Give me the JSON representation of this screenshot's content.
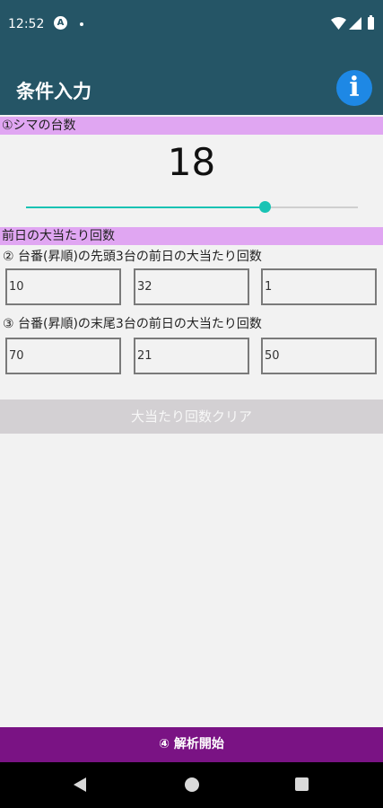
{
  "status_bar": {
    "time": "12:52",
    "a_icon_letter": "A",
    "icons": [
      "a-icon",
      "dot-icon",
      "wifi-icon",
      "signal-icon",
      "battery-icon"
    ]
  },
  "app_bar": {
    "title": "条件入力",
    "info_icon_glyph": "i",
    "background": "#255566",
    "info_color": "#1e88e5"
  },
  "section1": {
    "header": "①シマの台数",
    "count_value": "18",
    "slider_fraction": 0.72,
    "accent": "#19c3b4",
    "header_bg": "#e0a6f2"
  },
  "section2": {
    "header": "前日の大当たり回数",
    "first_label": "② 台番(昇順)の先頭3台の前日の大当たり回数",
    "first_values": [
      "10",
      "32",
      "1"
    ],
    "last_label": "③ 台番(昇順)の末尾3台の前日の大当たり回数",
    "last_values": [
      "70",
      "21",
      "50"
    ]
  },
  "buttons": {
    "clear_label": "大当たり回数クリア",
    "start_label": "④ 解析開始",
    "start_color": "#7a1384"
  },
  "nav": {
    "icons": [
      "back-icon",
      "home-icon",
      "recents-icon"
    ]
  }
}
